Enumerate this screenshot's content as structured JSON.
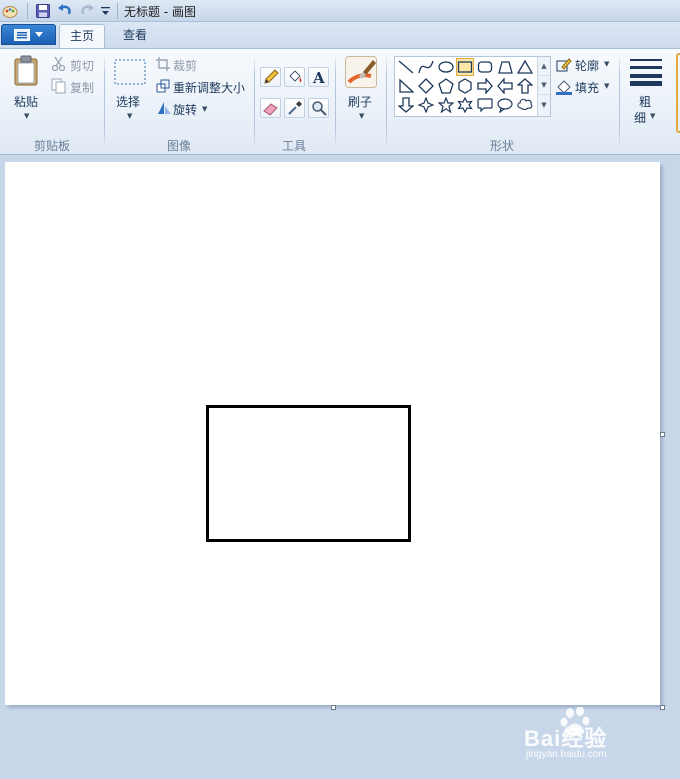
{
  "window": {
    "title": "无标题 - 画图"
  },
  "quick_access": {
    "icons": [
      "paint-app-icon",
      "save-icon",
      "undo-icon",
      "redo-icon",
      "customize-dropdown-icon"
    ]
  },
  "tabs": [
    {
      "label": "主页",
      "active": true
    },
    {
      "label": "查看",
      "active": false
    }
  ],
  "ribbon": {
    "clipboard": {
      "group_label": "剪贴板",
      "paste_label": "粘贴",
      "cut_label": "剪切",
      "copy_label": "复制"
    },
    "image": {
      "group_label": "图像",
      "select_label": "选择",
      "crop_label": "裁剪",
      "resize_label": "重新调整大小",
      "rotate_label": "旋转"
    },
    "tools": {
      "group_label": "工具",
      "items": [
        "pencil-icon",
        "fill-bucket-icon",
        "text-icon",
        "eraser-icon",
        "color-picker-icon",
        "magnifier-icon"
      ]
    },
    "brushes": {
      "label": "刷子"
    },
    "shapes": {
      "group_label": "形状",
      "outline_label": "轮廓",
      "fill_label": "填充",
      "selected_shape": "rectangle"
    },
    "size": {
      "label_line1": "粗",
      "label_line2": "细"
    }
  },
  "colors": {
    "accent_blue": "#1a5fb4",
    "selected_shape_bg": "#fde7a6",
    "canvas_bg": "#ffffff",
    "workspace_bg": "#c8d6ea",
    "drawn_stroke": "#000000"
  },
  "watermark": {
    "text": "Bai经验",
    "subtext": "jingyan.baidu.com"
  }
}
